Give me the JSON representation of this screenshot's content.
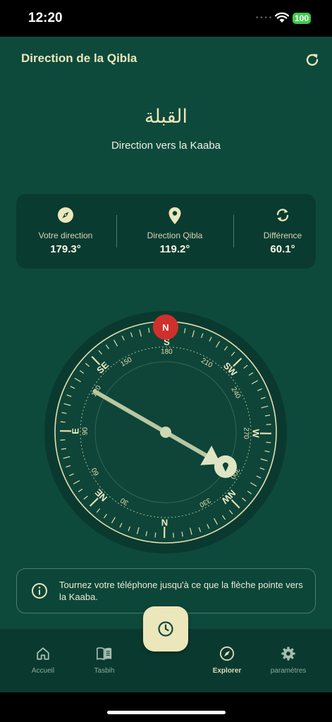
{
  "status": {
    "time": "12:20",
    "battery": "100"
  },
  "header": {
    "title": "Direction de la Qibla"
  },
  "hero": {
    "arabic": "القبلة",
    "subtitle": "Direction vers la Kaaba"
  },
  "stats": [
    {
      "label": "Votre direction",
      "value": "179.3°",
      "icon": "compass-icon"
    },
    {
      "label": "Direction Qibla",
      "value": "119.2°",
      "icon": "location-pin-icon"
    },
    {
      "label": "Différence",
      "value": "60.1°",
      "icon": "sync-icon"
    }
  ],
  "compass": {
    "north_badge": "N",
    "heading_deg": 179.3,
    "qibla_deg": 119.2,
    "cardinals": [
      {
        "label": "N",
        "deg": 0
      },
      {
        "label": "NE",
        "deg": 45
      },
      {
        "label": "E",
        "deg": 90
      },
      {
        "label": "SE",
        "deg": 135
      },
      {
        "label": "S",
        "deg": 180
      },
      {
        "label": "SW",
        "deg": 225
      },
      {
        "label": "W",
        "deg": 270
      },
      {
        "label": "NW",
        "deg": 315
      }
    ],
    "degree_labels": [
      "30",
      "60",
      "90",
      "120",
      "150",
      "180",
      "210",
      "240",
      "270",
      "300",
      "330"
    ]
  },
  "hint": {
    "text": "Tournez votre téléphone jusqu'à ce que la flèche pointe vers la Kaaba."
  },
  "nav": [
    {
      "label": "Accueil",
      "icon": "home-icon"
    },
    {
      "label": "Tasbih",
      "icon": "book-icon"
    },
    {
      "label": "Explorer",
      "icon": "compass-icon"
    },
    {
      "label": "paramètres",
      "icon": "gear-icon"
    }
  ],
  "fab": {
    "icon": "clock-icon"
  },
  "colors": {
    "background": "#0d4a3c",
    "accent": "#ece6bb",
    "north": "#d0302b"
  }
}
